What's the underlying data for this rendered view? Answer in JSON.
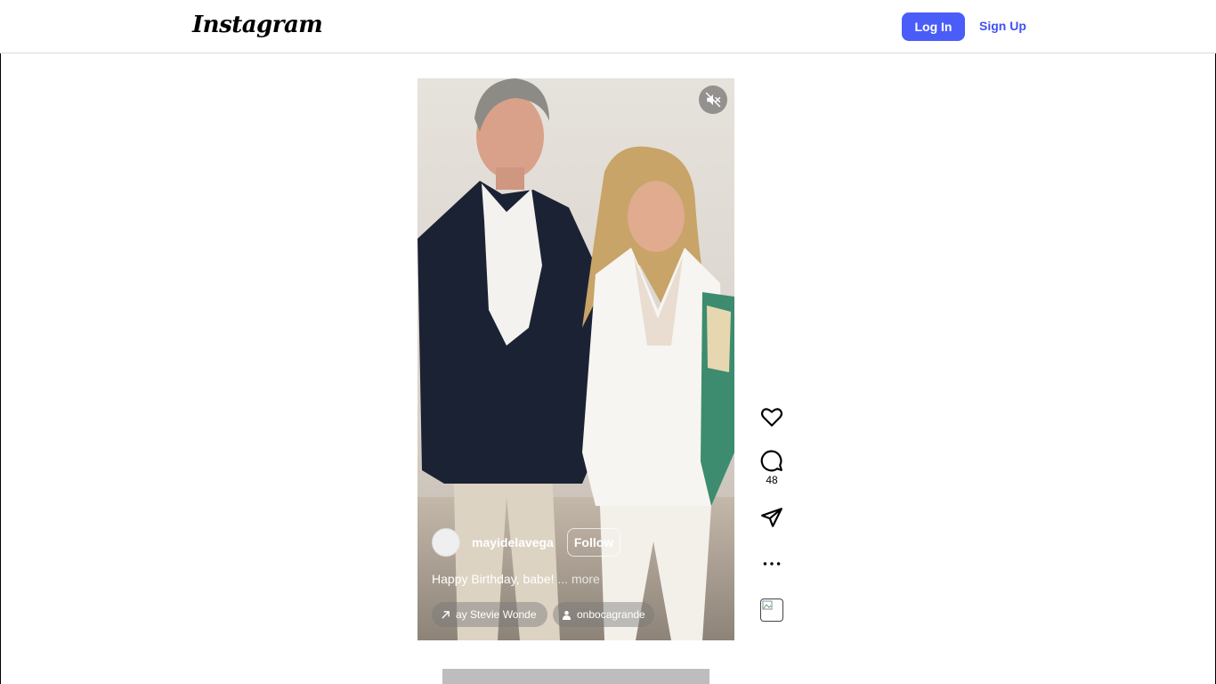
{
  "header": {
    "logo_text": "Instagram",
    "login_label": "Log In",
    "signup_label": "Sign Up"
  },
  "reel": {
    "username": "mayidelavega",
    "follow_label": "Follow",
    "caption": "Happy Birthday, babe!",
    "more_label": "... more",
    "audio_text": "ay  Stevie Wonde",
    "tagged_user": "onbocagrande",
    "muted": true
  },
  "actions": {
    "comment_count": "48"
  },
  "colors": {
    "primary_button": "#4a5df9",
    "link": "#4150f7"
  }
}
